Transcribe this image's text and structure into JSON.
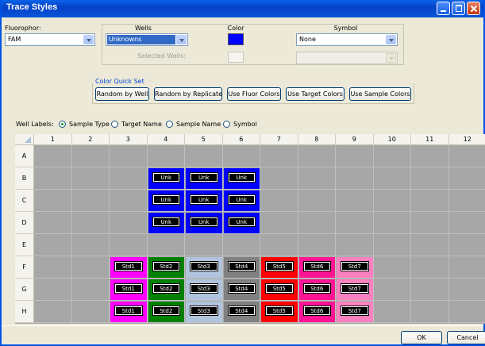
{
  "window": {
    "title": "Trace Styles"
  },
  "fluorophor": {
    "label": "Fluorophor:",
    "value": "FAM"
  },
  "wells": {
    "header": "Wells",
    "value": "Unknowns",
    "selected_label": "Selected Wells:"
  },
  "color": {
    "header": "Color",
    "value": "#0000ff"
  },
  "symbol": {
    "header": "Symbol",
    "value": "None"
  },
  "quick_set": {
    "label": "Color Quick Set",
    "buttons": [
      "Random by Well",
      "Random by Replicate",
      "Use Fluor Colors",
      "Use Target Colors",
      "Use Sample Colors"
    ]
  },
  "well_labels": {
    "label": "Well Labels:",
    "options": [
      "Sample Type",
      "Target Name",
      "Sample Name",
      "Symbol"
    ],
    "selected": "Sample Type"
  },
  "grid": {
    "columns": [
      "1",
      "2",
      "3",
      "4",
      "5",
      "6",
      "7",
      "8",
      "9",
      "10",
      "11",
      "12"
    ],
    "rows": [
      "A",
      "B",
      "C",
      "D",
      "E",
      "F",
      "G",
      "H"
    ],
    "cell_color": "#a7a7a7",
    "wells": [
      {
        "row": "B",
        "col": "4",
        "label": "Unk",
        "color": "#0000ff"
      },
      {
        "row": "B",
        "col": "5",
        "label": "Unk",
        "color": "#0000ff"
      },
      {
        "row": "B",
        "col": "6",
        "label": "Unk",
        "color": "#0000ff"
      },
      {
        "row": "C",
        "col": "4",
        "label": "Unk",
        "color": "#0000ff"
      },
      {
        "row": "C",
        "col": "5",
        "label": "Unk",
        "color": "#0000ff"
      },
      {
        "row": "C",
        "col": "6",
        "label": "Unk",
        "color": "#0000ff"
      },
      {
        "row": "D",
        "col": "4",
        "label": "Unk",
        "color": "#0000ff"
      },
      {
        "row": "D",
        "col": "5",
        "label": "Unk",
        "color": "#0000ff"
      },
      {
        "row": "D",
        "col": "6",
        "label": "Unk",
        "color": "#0000ff"
      },
      {
        "row": "F",
        "col": "3",
        "label": "Std1",
        "color": "#ff00ff"
      },
      {
        "row": "F",
        "col": "4",
        "label": "Std2",
        "color": "#008000"
      },
      {
        "row": "F",
        "col": "5",
        "label": "Std3",
        "color": "#b0c4de"
      },
      {
        "row": "F",
        "col": "6",
        "label": "Std4",
        "color": "#808080"
      },
      {
        "row": "F",
        "col": "7",
        "label": "Std5",
        "color": "#ff0000"
      },
      {
        "row": "F",
        "col": "8",
        "label": "Std6",
        "color": "#ff1493"
      },
      {
        "row": "F",
        "col": "9",
        "label": "Std7",
        "color": "#ff80c0"
      },
      {
        "row": "G",
        "col": "3",
        "label": "Std1",
        "color": "#ff00ff"
      },
      {
        "row": "G",
        "col": "4",
        "label": "Std2",
        "color": "#008000"
      },
      {
        "row": "G",
        "col": "5",
        "label": "Std3",
        "color": "#b0c4de"
      },
      {
        "row": "G",
        "col": "6",
        "label": "Std4",
        "color": "#808080"
      },
      {
        "row": "G",
        "col": "7",
        "label": "Std5",
        "color": "#ff0000"
      },
      {
        "row": "G",
        "col": "8",
        "label": "Std6",
        "color": "#ff1493"
      },
      {
        "row": "G",
        "col": "9",
        "label": "Std7",
        "color": "#ff80c0"
      },
      {
        "row": "H",
        "col": "3",
        "label": "Std1",
        "color": "#ff00ff"
      },
      {
        "row": "H",
        "col": "4",
        "label": "Std2",
        "color": "#008000"
      },
      {
        "row": "H",
        "col": "5",
        "label": "Std3",
        "color": "#b0c4de"
      },
      {
        "row": "H",
        "col": "6",
        "label": "Std4",
        "color": "#808080"
      },
      {
        "row": "H",
        "col": "7",
        "label": "Std5",
        "color": "#ff0000"
      },
      {
        "row": "H",
        "col": "8",
        "label": "Std6",
        "color": "#ff1493"
      },
      {
        "row": "H",
        "col": "9",
        "label": "Std7",
        "color": "#ff80c0"
      }
    ]
  },
  "footer": {
    "ok": "OK",
    "cancel": "Cancel"
  }
}
